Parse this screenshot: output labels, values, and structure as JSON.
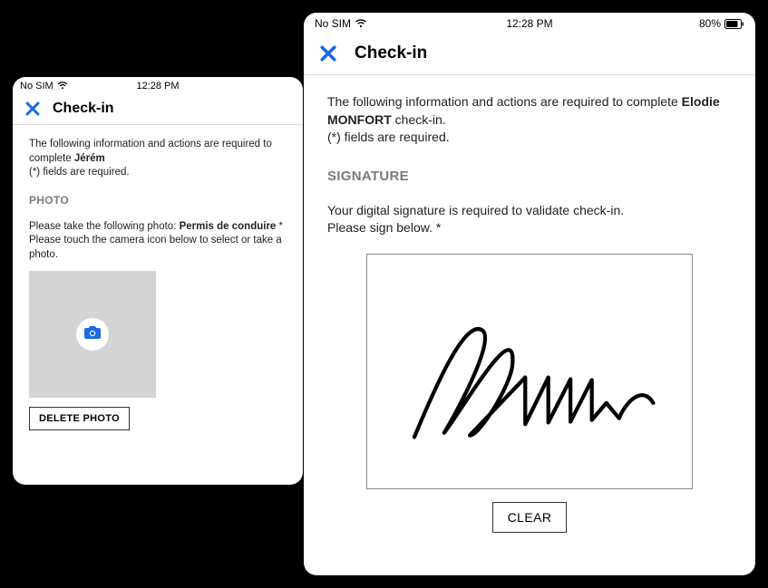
{
  "status": {
    "carrier": "No SIM",
    "time": "12:28 PM",
    "battery_pct": "80%"
  },
  "left": {
    "header_title": "Check-in",
    "intro_prefix": "The following information and actions are required to complete ",
    "guest_name": "Jérém",
    "required_note": "(*) fields are required.",
    "section_title": "PHOTO",
    "photo_line_prefix": "Please take the following photo: ",
    "photo_doc": "Permis de conduire",
    "photo_required_mark": " *",
    "photo_line2": "Please touch the camera icon below to select or take a photo.",
    "delete_label": "DELETE PHOTO"
  },
  "right": {
    "header_title": "Check-in",
    "intro_prefix": "The following information and actions are required to complete ",
    "guest_name": "Elodie MONFORT",
    "intro_suffix": " check-in.",
    "required_note": "(*) fields are required.",
    "section_title": "SIGNATURE",
    "sig_line1": "Your digital signature is required to validate check-in.",
    "sig_line2": "Please sign below. *",
    "clear_label": "CLEAR"
  }
}
